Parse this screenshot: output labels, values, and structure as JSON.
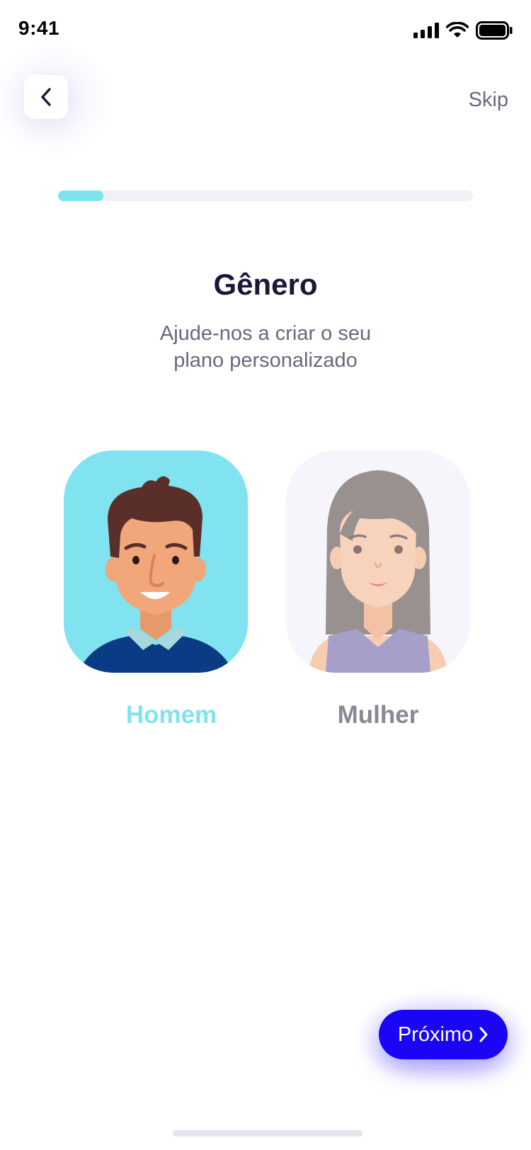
{
  "status_bar": {
    "time": "9:41"
  },
  "header": {
    "skip_label": "Skip"
  },
  "progress": {
    "value": 0.11,
    "fill_color": "#7fe3ef"
  },
  "content": {
    "title": "Gênero",
    "subtitle_line1": "Ajude-nos a criar o seu",
    "subtitle_line2": "plano personalizado"
  },
  "options": [
    {
      "label": "Homem",
      "selected": true,
      "icon": "male-avatar-icon"
    },
    {
      "label": "Mulher",
      "selected": false,
      "icon": "female-avatar-icon"
    }
  ],
  "footer": {
    "next_label": "Próximo"
  },
  "colors": {
    "accent": "#80e3ef",
    "primary": "#1a06f5",
    "text_dark": "#1a1838",
    "text_muted": "#6b6780"
  }
}
